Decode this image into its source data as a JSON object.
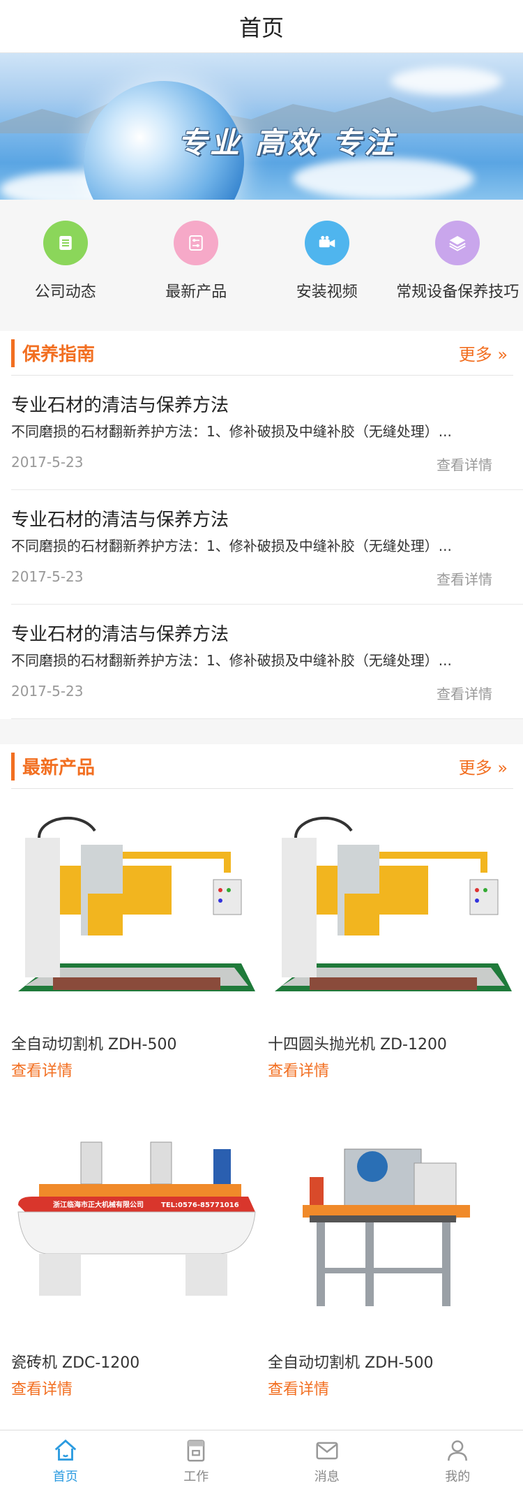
{
  "header": {
    "title": "首页"
  },
  "banner": {
    "slogan": "专业  高效  专注"
  },
  "quicknav": {
    "items": [
      {
        "label": "公司动态",
        "icon": "list-icon",
        "color": "#8bd65a"
      },
      {
        "label": "最新产品",
        "icon": "sliders-icon",
        "color": "#f6a9c8"
      },
      {
        "label": "安装视频",
        "icon": "video-camera-icon",
        "color": "#4fb5ee"
      },
      {
        "label": "常规设备保养技巧",
        "icon": "layers-icon",
        "color": "#c9a6ec"
      }
    ]
  },
  "guide": {
    "title": "保养指南",
    "more": "更多 »",
    "articles": [
      {
        "title": "专业石材的清洁与保养方法",
        "desc": "不同磨损的石材翻新养护方法：1、修补破损及中缝补胶（无缝处理）...",
        "date": "2017-5-23",
        "detail": "查看详情"
      },
      {
        "title": "专业石材的清洁与保养方法",
        "desc": "不同磨损的石材翻新养护方法：1、修补破损及中缝补胶（无缝处理）...",
        "date": "2017-5-23",
        "detail": "查看详情"
      },
      {
        "title": "专业石材的清洁与保养方法",
        "desc": "不同磨损的石材翻新养护方法：1、修补破损及中缝补胶（无缝处理）...",
        "date": "2017-5-23",
        "detail": "查看详情"
      }
    ]
  },
  "products": {
    "title": "最新产品",
    "more": "更多 »",
    "items": [
      {
        "name": "全自动切割机 ZDH-500",
        "link": "查看详情"
      },
      {
        "name": "十四圆头抛光机 ZD-1200",
        "link": "查看详情"
      },
      {
        "name": "瓷砖机 ZDC-1200",
        "link": "查看详情",
        "plate_left": "浙江临海市正大机械有限公司",
        "plate_right": "TEL:0576-85771016"
      },
      {
        "name": "全自动切割机 ZDH-500",
        "link": "查看详情"
      }
    ]
  },
  "tabbar": {
    "items": [
      {
        "label": "首页",
        "icon": "home-icon",
        "active": true
      },
      {
        "label": "工作",
        "icon": "clipboard-icon",
        "active": false
      },
      {
        "label": "消息",
        "icon": "mail-icon",
        "active": false
      },
      {
        "label": "我的",
        "icon": "user-icon",
        "active": false
      }
    ]
  },
  "colors": {
    "accent": "#f26f21",
    "tab_active": "#2b9be0"
  }
}
